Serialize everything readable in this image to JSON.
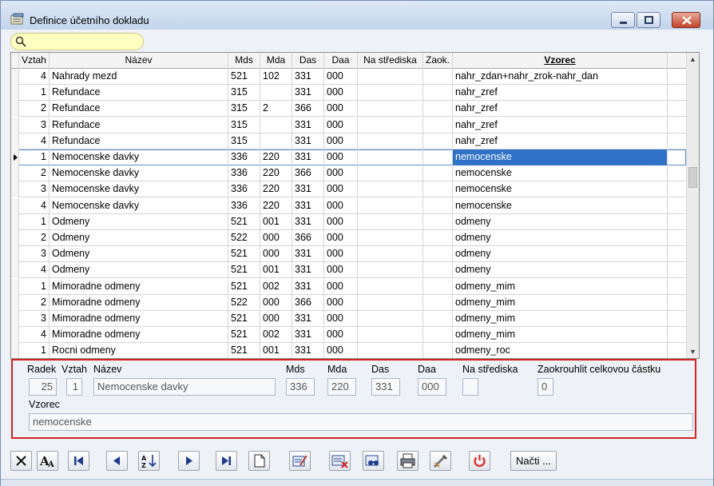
{
  "window": {
    "title": "Definice účetního dokladu"
  },
  "search": {
    "icon": "search-icon",
    "value": ""
  },
  "grid": {
    "columns": [
      "Vztah",
      "Název",
      "Mds",
      "Mda",
      "Das",
      "Daa",
      "Na střediska",
      "Zaok.",
      "Vzorec"
    ],
    "rows": [
      [
        "4",
        "Nahrady mezd",
        "521",
        "102",
        "331",
        "000",
        "",
        "",
        "nahr_zdan+nahr_zrok-nahr_dan"
      ],
      [
        "1",
        "Refundace",
        "315",
        "",
        "331",
        "000",
        "",
        "",
        "nahr_zref"
      ],
      [
        "2",
        "Refundace",
        "315",
        "2",
        "366",
        "000",
        "",
        "",
        "nahr_zref"
      ],
      [
        "3",
        "Refundace",
        "315",
        "",
        "331",
        "000",
        "",
        "",
        "nahr_zref"
      ],
      [
        "4",
        "Refundace",
        "315",
        "",
        "331",
        "000",
        "",
        "",
        "nahr_zref"
      ],
      [
        "1",
        "Nemocenske davky",
        "336",
        "220",
        "331",
        "000",
        "",
        "",
        "nemocenske"
      ],
      [
        "2",
        "Nemocenske davky",
        "336",
        "220",
        "366",
        "000",
        "",
        "",
        "nemocenske"
      ],
      [
        "3",
        "Nemocenske davky",
        "336",
        "220",
        "331",
        "000",
        "",
        "",
        "nemocenske"
      ],
      [
        "4",
        "Nemocenske davky",
        "336",
        "220",
        "331",
        "000",
        "",
        "",
        "nemocenske"
      ],
      [
        "1",
        "Odmeny",
        "521",
        "001",
        "331",
        "000",
        "",
        "",
        "odmeny"
      ],
      [
        "2",
        "Odmeny",
        "522",
        "000",
        "366",
        "000",
        "",
        "",
        "odmeny"
      ],
      [
        "3",
        "Odmeny",
        "521",
        "000",
        "331",
        "000",
        "",
        "",
        "odmeny"
      ],
      [
        "4",
        "Odmeny",
        "521",
        "001",
        "331",
        "000",
        "",
        "",
        "odmeny"
      ],
      [
        "1",
        "Mimoradne odmeny",
        "521",
        "002",
        "331",
        "000",
        "",
        "",
        "odmeny_mim"
      ],
      [
        "2",
        "Mimoradne odmeny",
        "522",
        "000",
        "366",
        "000",
        "",
        "",
        "odmeny_mim"
      ],
      [
        "3",
        "Mimoradne odmeny",
        "521",
        "000",
        "331",
        "000",
        "",
        "",
        "odmeny_mim"
      ],
      [
        "4",
        "Mimoradne odmeny",
        "521",
        "002",
        "331",
        "000",
        "",
        "",
        "odmeny_mim"
      ],
      [
        "1",
        "Rocni odmeny",
        "521",
        "001",
        "331",
        "000",
        "",
        "",
        "odmeny_roc"
      ]
    ],
    "selected_row": 5
  },
  "detail": {
    "labels": {
      "radek": "Radek",
      "vztah": "Vztah",
      "nazev": "Název",
      "mds": "Mds",
      "mda": "Mda",
      "das": "Das",
      "daa": "Daa",
      "na_strediska": "Na střediska",
      "zaokrouhlit": "Zaokrouhlit celkovou částku",
      "vzorec": "Vzorec"
    },
    "values": {
      "radek": "25",
      "vztah": "1",
      "nazev": "Nemocenske davky",
      "mds": "336",
      "mda": "220",
      "das": "331",
      "daa": "000",
      "na_strediska": "",
      "zaokrouhlit": "0",
      "vzorec": "nemocenske"
    }
  },
  "toolbar": {
    "buttons": [
      "close-filter-icon",
      "font-icon",
      "first-record-icon",
      "previous-record-icon",
      "sort-az-icon",
      "next-record-icon",
      "last-record-icon",
      "new-record-icon",
      "edit-record-icon",
      "delete-record-icon",
      "search-records-icon",
      "print-icon",
      "tools-icon",
      "power-icon"
    ],
    "load_label": "Načti ..."
  },
  "colors": {
    "selection": "#2f72c8",
    "detail_border": "#d32323",
    "search_bg": "#ffffc2"
  }
}
